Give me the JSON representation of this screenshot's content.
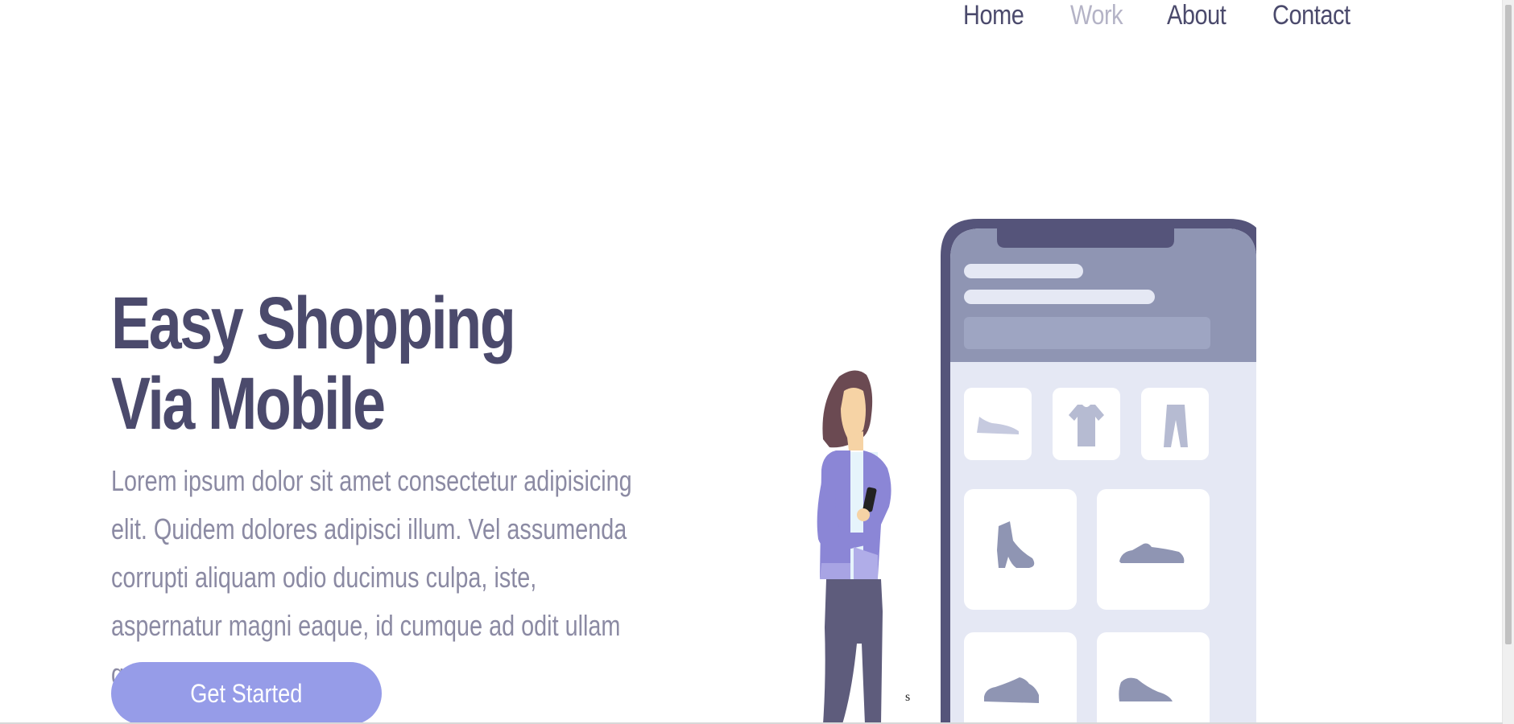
{
  "nav": {
    "items": [
      {
        "label": "Home",
        "active": false
      },
      {
        "label": "Work",
        "active": true
      },
      {
        "label": "About",
        "active": false
      },
      {
        "label": "Contact",
        "active": false
      }
    ]
  },
  "hero": {
    "title_line1": "Easy Shopping",
    "title_line2": "Via Mobile",
    "description": "Lorem ipsum dolor sit amet consectetur adipisicing elit. Quidem dolores adipisci illum. Vel assumenda corrupti aliquam odio ducimus culpa, iste, aspernatur magni eaque, id cumque ad odit ullam quae earum?",
    "cta_label": "Get Started"
  },
  "stray_text": "s",
  "colors": {
    "primary_text": "#4b4a6c",
    "muted_text": "#8b8aa3",
    "nav_active": "#b4b3c6",
    "accent": "#969ce8",
    "phone_frame": "#55547a",
    "phone_header": "#8f95b3",
    "phone_screen": "#e5e8f4"
  },
  "illustration": {
    "product_icons": [
      "flat-shoe-icon",
      "t-shirt-icon",
      "trousers-icon",
      "ankle-boot-icon",
      "sneaker-icon",
      "sneaker-icon",
      "sneaker-icon"
    ]
  }
}
